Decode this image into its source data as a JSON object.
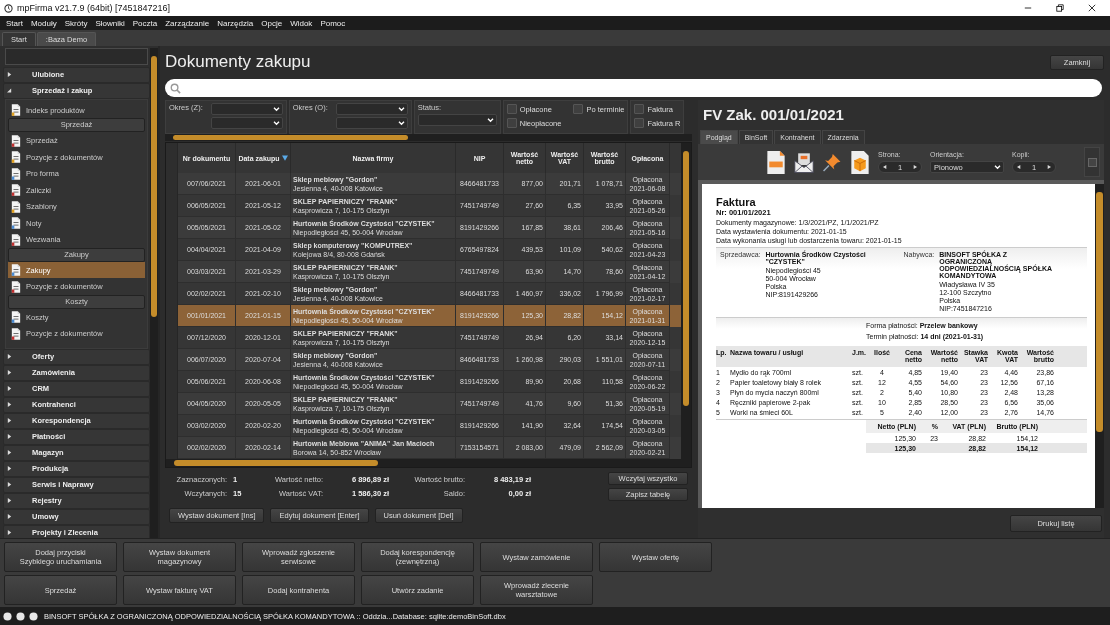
{
  "window": {
    "title": "mpFirma v21.7.9 (64bit) [7451847216]"
  },
  "menu": [
    "Start",
    "Moduły",
    "Skróty",
    "Słowniki",
    "Poczta",
    "Zarządzanie",
    "Narzędzia",
    "Opcje",
    "Widok",
    "Pomoc"
  ],
  "tabs": [
    {
      "label": "Start",
      "selected": false
    },
    {
      "label": ":Baza Demo",
      "selected": true
    }
  ],
  "sidebar": {
    "sections": [
      {
        "label": "Ulubione",
        "expanded": false
      },
      {
        "label": "Sprzedaż i zakup",
        "expanded": true,
        "items": [
          {
            "kind": "item",
            "label": "Indeks produktów",
            "selected": false
          },
          {
            "kind": "header",
            "label": "Sprzedaż"
          },
          {
            "kind": "item",
            "label": "Sprzedaż",
            "selected": false
          },
          {
            "kind": "item",
            "label": "Pozycje z dokumentów",
            "selected": false
          },
          {
            "kind": "item",
            "label": "Pro forma",
            "selected": false
          },
          {
            "kind": "item",
            "label": "Zaliczki",
            "selected": false
          },
          {
            "kind": "item",
            "label": "Szablony",
            "selected": false
          },
          {
            "kind": "item",
            "label": "Noty",
            "selected": false
          },
          {
            "kind": "item",
            "label": "Wezwania",
            "selected": false
          },
          {
            "kind": "header",
            "label": "Zakupy"
          },
          {
            "kind": "item",
            "label": "Zakupy",
            "selected": true
          },
          {
            "kind": "item",
            "label": "Pozycje z dokumentów",
            "selected": false
          },
          {
            "kind": "header",
            "label": "Koszty"
          },
          {
            "kind": "item",
            "label": "Koszty",
            "selected": false
          },
          {
            "kind": "item",
            "label": "Pozycje z dokumentów",
            "selected": false
          }
        ]
      },
      {
        "label": "Oferty",
        "expanded": false
      },
      {
        "label": "Zamówienia",
        "expanded": false
      },
      {
        "label": "CRM",
        "expanded": false
      },
      {
        "label": "Kontrahenci",
        "expanded": false
      },
      {
        "label": "Korespondencja",
        "expanded": false
      },
      {
        "label": "Płatności",
        "expanded": false
      },
      {
        "label": "Magazyn",
        "expanded": false
      },
      {
        "label": "Produkcja",
        "expanded": false
      },
      {
        "label": "Serwis i Naprawy",
        "expanded": false
      },
      {
        "label": "Rejestry",
        "expanded": false
      },
      {
        "label": "Umowy",
        "expanded": false
      },
      {
        "label": "Projekty i Zlecenia",
        "expanded": false
      }
    ]
  },
  "page": {
    "title": "Dokumenty zakupu",
    "close_button": "Zamknij"
  },
  "filters": {
    "period_purchase": "Okres (Z):",
    "period_payment": "Okres (O):",
    "status": "Status:",
    "checkbox_groups": [
      [
        {
          "label": "Opłacone",
          "checked": false
        },
        {
          "label": "Po terminie",
          "checked": false
        },
        {
          "label": "Nieopłacone",
          "checked": false
        }
      ],
      [
        {
          "label": "Faktura",
          "checked": false
        },
        {
          "label": "Faktura R",
          "checked": false
        }
      ]
    ]
  },
  "table": {
    "columns": [
      {
        "label": "Nr dokumentu",
        "sorted": false
      },
      {
        "label": "Data zakupu",
        "sorted": true
      },
      {
        "label": "Nazwa firmy",
        "sorted": false
      },
      {
        "label": "NIP",
        "sorted": false
      },
      {
        "label": "Wartość netto",
        "sorted": false
      },
      {
        "label": "Wartość VAT",
        "sorted": false
      },
      {
        "label": "Wartość brutto",
        "sorted": false
      },
      {
        "label": "Opłacona",
        "sorted": false
      }
    ],
    "rows": [
      {
        "number": "007/06/2021",
        "date": "2021-06-01",
        "company": "Sklep meblowy \"Gordon\"",
        "address": "Jesienna 4, 40-008 Katowice",
        "nip": "8466481733",
        "net": "877,00",
        "vat": "201,71",
        "gross": "1 078,71",
        "status": "Opłacona",
        "paid": "2021-06-08",
        "selected": false
      },
      {
        "number": "006/05/2021",
        "date": "2021-05-12",
        "company": "SKLEP PAPIERNICZY \"FRANK\"",
        "address": "Kasprowicza 7, 10-175 Olsztyn",
        "nip": "7451749749",
        "net": "27,60",
        "vat": "6,35",
        "gross": "33,95",
        "status": "Opłacona",
        "paid": "2021-05-26",
        "selected": false
      },
      {
        "number": "005/05/2021",
        "date": "2021-05-02",
        "company": "Hurtownia Środków Czystości \"CZYSTEK\"",
        "address": "Niepodległości 45, 50-004 Wrocław",
        "nip": "8191429266",
        "net": "167,85",
        "vat": "38,61",
        "gross": "206,46",
        "status": "Opłacona",
        "paid": "2021-05-16",
        "selected": false
      },
      {
        "number": "004/04/2021",
        "date": "2021-04-09",
        "company": "Sklep komputerowy \"KOMPUTREX\"",
        "address": "Kolejowa 8/4, 80-008 Gdańsk",
        "nip": "6765497824",
        "net": "439,53",
        "vat": "101,09",
        "gross": "540,62",
        "status": "Opłacona",
        "paid": "2021-04-23",
        "selected": false
      },
      {
        "number": "003/03/2021",
        "date": "2021-03-29",
        "company": "SKLEP PAPIERNICZY \"FRANK\"",
        "address": "Kasprowicza 7, 10-175 Olsztyn",
        "nip": "7451749749",
        "net": "63,90",
        "vat": "14,70",
        "gross": "78,60",
        "status": "Opłacona",
        "paid": "2021-04-12",
        "selected": false
      },
      {
        "number": "002/02/2021",
        "date": "2021-02-10",
        "company": "Sklep meblowy \"Gordon\"",
        "address": "Jesienna 4, 40-008 Katowice",
        "nip": "8466481733",
        "net": "1 460,97",
        "vat": "336,02",
        "gross": "1 796,99",
        "status": "Opłacona",
        "paid": "2021-02-17",
        "selected": false
      },
      {
        "number": "001/01/2021",
        "date": "2021-01-15",
        "company": "Hurtownia Środków Czystości \"CZYSTEK\"",
        "address": "Niepodległości 45, 50-004 Wrocław",
        "nip": "8191429266",
        "net": "125,30",
        "vat": "28,82",
        "gross": "154,12",
        "status": "Opłacona",
        "paid": "2021-01-31",
        "selected": true
      },
      {
        "number": "007/12/2020",
        "date": "2020-12-01",
        "company": "SKLEP PAPIERNICZY \"FRANK\"",
        "address": "Kasprowicza 7, 10-175 Olsztyn",
        "nip": "7451749749",
        "net": "26,94",
        "vat": "6,20",
        "gross": "33,14",
        "status": "Opłacona",
        "paid": "2020-12-15",
        "selected": false
      },
      {
        "number": "006/07/2020",
        "date": "2020-07-04",
        "company": "Sklep meblowy \"Gordon\"",
        "address": "Jesienna 4, 40-008 Katowice",
        "nip": "8466481733",
        "net": "1 260,98",
        "vat": "290,03",
        "gross": "1 551,01",
        "status": "Opłacona",
        "paid": "2020-07-11",
        "selected": false
      },
      {
        "number": "005/06/2021",
        "date": "2020-06-08",
        "company": "Hurtownia Środków Czystości \"CZYSTEK\"",
        "address": "Niepodległości 45, 50-004 Wrocław",
        "nip": "8191429266",
        "net": "89,90",
        "vat": "20,68",
        "gross": "110,58",
        "status": "Opłacona",
        "paid": "2020-06-22",
        "selected": false
      },
      {
        "number": "004/05/2020",
        "date": "2020-05-05",
        "company": "SKLEP PAPIERNICZY \"FRANK\"",
        "address": "Kasprowicza 7, 10-175 Olsztyn",
        "nip": "7451749749",
        "net": "41,76",
        "vat": "9,60",
        "gross": "51,36",
        "status": "Opłacona",
        "paid": "2020-05-19",
        "selected": false
      },
      {
        "number": "003/02/2020",
        "date": "2020-02-20",
        "company": "Hurtownia Środków Czystości \"CZYSTEK\"",
        "address": "Niepodległości 45, 50-004 Wrocław",
        "nip": "8191429266",
        "net": "141,90",
        "vat": "32,64",
        "gross": "174,54",
        "status": "Opłacona",
        "paid": "2020-03-05",
        "selected": false
      },
      {
        "number": "002/02/2020",
        "date": "2020-02-14",
        "company": "Hurtownia Meblowa \"ANIMA\" Jan Macioch",
        "address": "Borowa 14, 50-852 Wrocław",
        "nip": "7153154571",
        "net": "2 083,00",
        "vat": "479,09",
        "gross": "2 562,09",
        "status": "Opłacona",
        "paid": "2020-02-21",
        "selected": false
      }
    ]
  },
  "summary": {
    "stats": [
      {
        "label": "Zaznaczonych:",
        "value": "1"
      },
      {
        "label": "Wczytanych:",
        "value": "15"
      }
    ],
    "totals": [
      {
        "label": "Wartość netto:",
        "value": "6 896,89 zł"
      },
      {
        "label": "Wartość VAT:",
        "value": "1 586,30 zł"
      },
      {
        "label": "Wartość brutto:",
        "value": "8 483,19 zł"
      },
      {
        "label": "Saldo:",
        "value": "0,00 zł"
      }
    ],
    "buttons": [
      "Wczytaj wszystko",
      "Zapisz tabelę"
    ]
  },
  "actions": [
    "Wystaw dokument [Ins]",
    "Edytuj dokument [Enter]",
    "Usuń dokument [Del]"
  ],
  "document": {
    "title": "FV Zak. 001/01/2021",
    "tabs": [
      {
        "label": "Podgląd",
        "selected": true
      },
      {
        "label": "BinSoft",
        "selected": false
      },
      {
        "label": "Kontrahent",
        "selected": false
      },
      {
        "label": "Zdarzenia",
        "selected": false
      }
    ],
    "toolbar": {
      "page_label": "Strona:",
      "page": "1",
      "orientation_label": "Orientacja:",
      "orientation": "Pionowo",
      "copies_label": "Kopii:",
      "copies": "1"
    },
    "invoice": {
      "heading": "Faktura",
      "number": "Nr: 001/01/2021",
      "meta": [
        "Dokumenty magazynowe: 1/3/2021/PZ, 1/1/2021/PZ",
        "Data wystawienia dokumentu: 2021-01-15",
        "Data wykonania usługi lub dostarczenia towaru: 2021-01-15"
      ],
      "seller": {
        "label": "Sprzedawca:",
        "name": "Hurtownia Środków Czystości \"CZYSTEK\"",
        "lines": [
          "Niepodległości 45",
          "50-004 Wrocław",
          "Polska",
          "NIP:8191429266"
        ]
      },
      "buyer": {
        "label": "Nabywca:",
        "name": "BINSOFT SPÓŁKA Z OGRANICZONĄ ODPOWIEDZIALNOŚCIĄ SPÓŁKA KOMANDYTOWA",
        "lines": [
          "Władysława IV 35",
          "12-100 Szczytno",
          "Polska",
          "NIP:7451847216"
        ]
      },
      "payment": [
        "Forma płatności: **Przelew bankowy**",
        "Termin płatności: **14 dni (2021-01-31)**"
      ],
      "columns": [
        "Lp.",
        "Nazwa towaru / usługi",
        "J.m.",
        "Ilość",
        "Cena netto",
        "Wartość netto",
        "Stawka VAT",
        "Kwota VAT",
        "Wartość brutto"
      ],
      "rows": [
        [
          "1",
          "Mydło do rąk 700ml",
          "szt.",
          "4",
          "4,85",
          "19,40",
          "23",
          "4,46",
          "23,86"
        ],
        [
          "2",
          "Papier toaletowy biały 8 rolek",
          "szt.",
          "12",
          "4,55",
          "54,60",
          "23",
          "12,56",
          "67,16"
        ],
        [
          "3",
          "Płyn do mycia naczyń 800ml",
          "szt.",
          "2",
          "5,40",
          "10,80",
          "23",
          "2,48",
          "13,28"
        ],
        [
          "4",
          "Ręczniki papierowe 2-pak",
          "szt.",
          "10",
          "2,85",
          "28,50",
          "23",
          "6,56",
          "35,06"
        ],
        [
          "5",
          "Worki na śmieci 60L",
          "szt.",
          "5",
          "2,40",
          "12,00",
          "23",
          "2,76",
          "14,76"
        ]
      ],
      "totals": {
        "columns": [
          "Netto (PLN)",
          "%",
          "VAT (PLN)",
          "Brutto (PLN)"
        ],
        "row": [
          "125,30",
          "23",
          "28,82",
          "154,12"
        ],
        "sum": [
          "125,30",
          "28,82",
          "154,12"
        ]
      }
    },
    "print_button": "Drukuj listę"
  },
  "quick_buttons": [
    "Dodaj przyciski Szybkiego uruchamiania",
    "Wystaw dokument magazynowy",
    "Wprowadź zgłoszenie serwisowe",
    "Dodaj korespondencję (zewnętrzną)",
    "Wystaw zamówienie",
    "Wystaw ofertę",
    "Sprzedaż",
    "Wystaw fakturę VAT",
    "Dodaj kontrahenta",
    "Utwórz zadanie",
    "Wprowadź zlecenie warsztatowe"
  ],
  "status_bar": "BINSOFT SPÓŁKA Z OGRANICZONĄ ODPOWIEDZIALNOŚCIĄ SPÓŁKA KOMANDYTOWA :: Oddzia...Database: sqlite:demoBinSoft.dbx"
}
